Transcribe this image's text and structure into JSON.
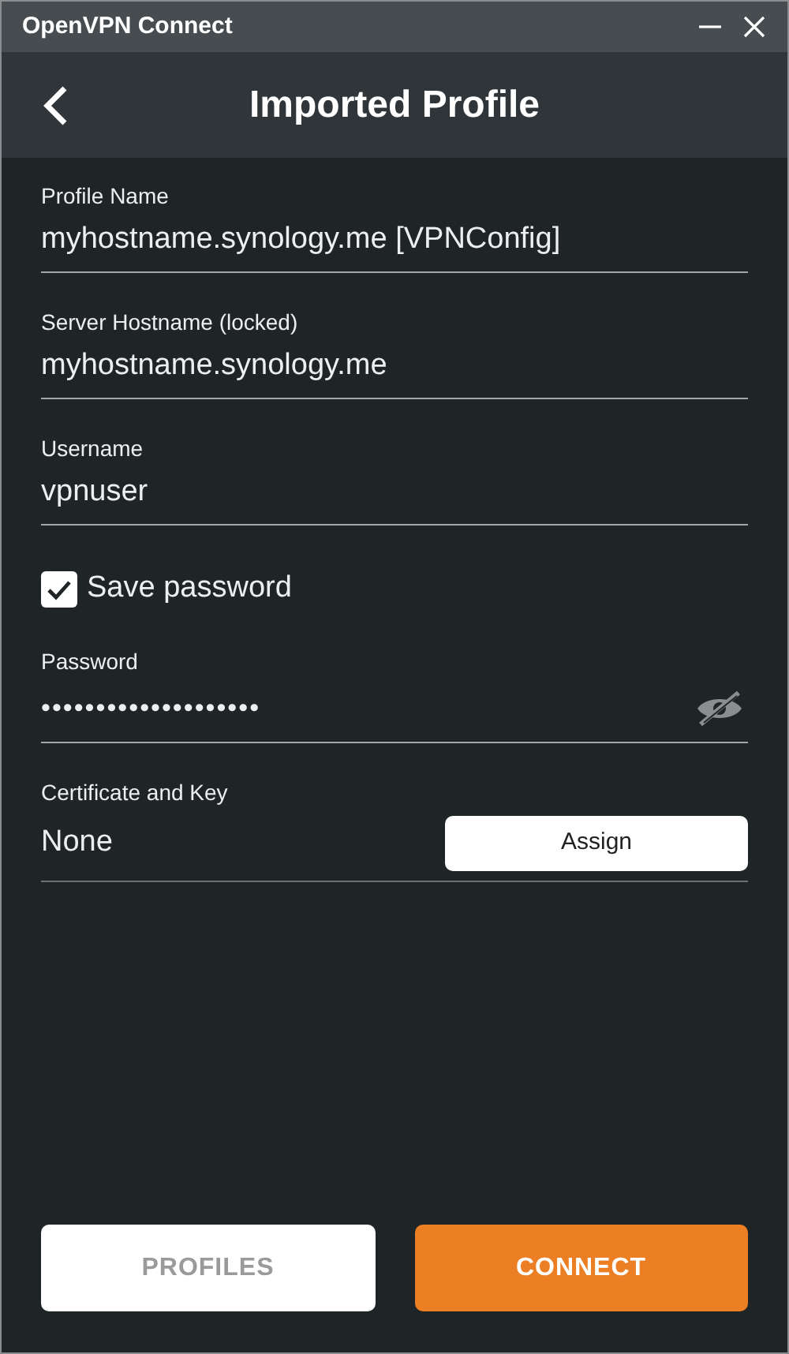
{
  "window": {
    "title": "OpenVPN Connect"
  },
  "header": {
    "title": "Imported Profile"
  },
  "fields": [
    {
      "kind": "text",
      "label": "Profile Name",
      "value": "myhostname.synology.me [VPNConfig]"
    },
    {
      "kind": "text",
      "label": "Server Hostname (locked)",
      "value": "myhostname.synology.me"
    },
    {
      "kind": "text",
      "label": "Username",
      "value": "vpnuser"
    },
    {
      "kind": "checkbox",
      "label": "Save password",
      "checked": true
    },
    {
      "kind": "password",
      "label": "Password",
      "value": "••••••••••••••••••••"
    },
    {
      "kind": "certificate",
      "label": "Certificate and Key",
      "value": "None",
      "button": "Assign"
    }
  ],
  "buttons": [
    {
      "label": "PROFILES",
      "kind": "secondary"
    },
    {
      "label": "CONNECT",
      "kind": "primary"
    }
  ]
}
